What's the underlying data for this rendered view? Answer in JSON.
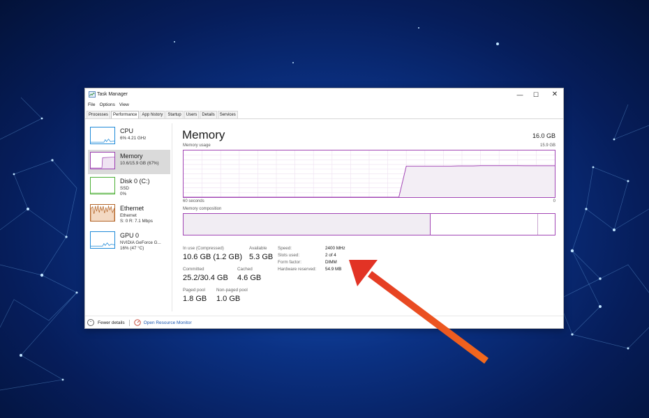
{
  "window": {
    "title": "Task Manager",
    "controls": {
      "minimize": "—",
      "maximize": "☐",
      "close": "✕"
    }
  },
  "menu": [
    "File",
    "Options",
    "View"
  ],
  "tabs": [
    "Processes",
    "Performance",
    "App history",
    "Startup",
    "Users",
    "Details",
    "Services"
  ],
  "active_tab": "Performance",
  "sidebar": {
    "items": [
      {
        "name": "CPU",
        "sub1": "6%  4.21 GHz",
        "sub2": "",
        "sub3": "",
        "color": "#1f8ad8",
        "icon": "cpu-graph-icon"
      },
      {
        "name": "Memory",
        "sub1": "10.6/15.9 GB (67%)",
        "sub2": "",
        "sub3": "",
        "color": "#9b3fb0",
        "icon": "memory-graph-icon"
      },
      {
        "name": "Disk 0 (C:)",
        "sub1": "SSD",
        "sub2": "0%",
        "sub3": "",
        "color": "#4caf35",
        "icon": "disk-graph-icon"
      },
      {
        "name": "Ethernet",
        "sub1": "Ethernet",
        "sub2": "S: 0  R: 7.1 Mbps",
        "sub3": "",
        "color": "#b4662a",
        "icon": "ethernet-graph-icon"
      },
      {
        "name": "GPU 0",
        "sub1": "NVIDIA GeForce G...",
        "sub2": "16% (47 °C)",
        "sub3": "",
        "color": "#1f8ad8",
        "icon": "gpu-graph-icon"
      }
    ],
    "selected": "Memory"
  },
  "main": {
    "title": "Memory",
    "total": "16.0 GB",
    "usage_label": "Memory usage",
    "usage_max": "15.9 GB",
    "axis_left": "60 seconds",
    "axis_right": "0",
    "composition_label": "Memory composition",
    "usage_series": [
      0,
      0,
      0,
      0,
      0,
      0,
      0,
      0,
      0,
      0,
      0,
      0,
      0,
      0,
      0,
      0,
      0,
      0,
      0,
      0,
      0,
      0,
      0,
      0,
      0,
      0,
      0,
      0,
      0,
      0,
      66.5,
      66.5,
      66.5,
      66.5,
      66.5,
      66.5,
      66.5,
      67,
      67,
      67,
      67.5,
      67.5,
      67.5,
      67.5,
      67.5,
      67.5,
      67.3,
      67.3,
      67.3,
      67.3,
      67.3
    ],
    "composition": {
      "in_use_fraction": 0.665,
      "standby_edge_fraction": 0.953
    },
    "stats": {
      "in_use_label": "In use (Compressed)",
      "in_use_value": "10.6 GB (1.2 GB)",
      "available_label": "Available",
      "available_value": "5.3 GB",
      "committed_label": "Committed",
      "committed_value": "25.2/30.4 GB",
      "cached_label": "Cached",
      "cached_value": "4.6 GB",
      "paged_label": "Paged pool",
      "paged_value": "1.8 GB",
      "nonpaged_label": "Non-paged pool",
      "nonpaged_value": "1.0 GB"
    },
    "specs": [
      {
        "label": "Speed:",
        "value": "2400 MHz"
      },
      {
        "label": "Slots used:",
        "value": "2 of 4"
      },
      {
        "label": "Form factor:",
        "value": "DIMM"
      },
      {
        "label": "Hardware reserved:",
        "value": "54.9 MB"
      }
    ]
  },
  "footer": {
    "fewer_details": "Fewer details",
    "resource_monitor": "Open Resource Monitor"
  },
  "colors": {
    "memory_accent": "#a245b5",
    "arrow_start": "#f26a1d",
    "arrow_end": "#e23325",
    "link": "#1a56b0"
  }
}
